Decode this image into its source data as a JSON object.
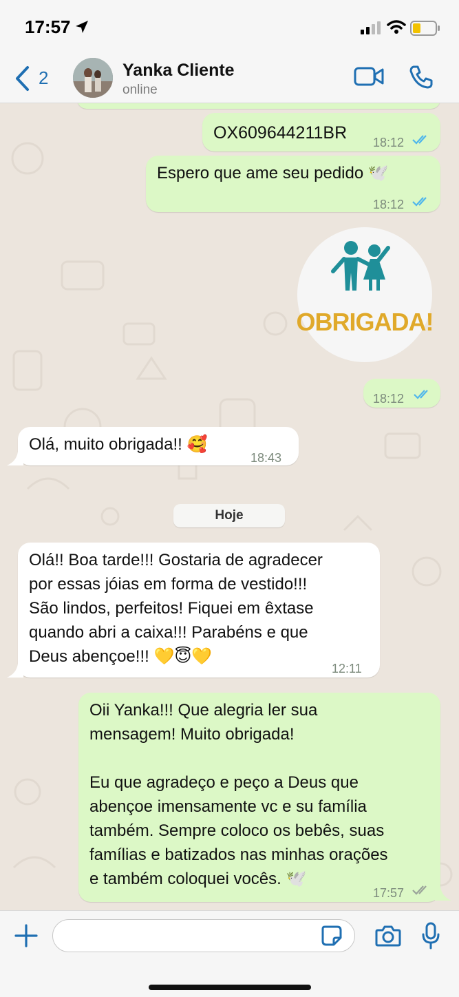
{
  "status_bar": {
    "time": "17:57"
  },
  "header": {
    "back_count": "2",
    "contact_name": "Yanka Cliente",
    "contact_status": "online"
  },
  "messages": [
    {
      "from": "me",
      "text": "OX609644211BR",
      "time": "18:12",
      "read": true
    },
    {
      "from": "me",
      "text": "Espero que ame seu pedido 🕊️",
      "time": "18:12",
      "read": true
    },
    {
      "from": "me",
      "type": "sticker",
      "sticker_text": "OBRIGADA!",
      "time": "18:12",
      "read": true
    },
    {
      "from": "them",
      "text": "Olá, muito obrigada!! 🥰",
      "time": "18:43"
    },
    {
      "from": "them",
      "text": "Olá!! Boa tarde!!! Gostaria de agradecer\npor essas jóias em forma de vestido!!!\nSão lindos, perfeitos! Fiquei em êxtase\nquando abri a caixa!!! Parabéns e que\nDeus abençoe!!! 💛😇💛",
      "time": "12:11"
    },
    {
      "from": "me",
      "text": "Oii Yanka!!! Que alegria ler sua\nmensagem! Muito obrigada!\n\nEu que agradeço e peço a Deus que\nabençoe imensamente vc e su família\ntambém. Sempre coloco os bebês, suas\nfamílias e batizados nas minhas orações\ne também coloquei vocês. 🕊️",
      "time": "17:57",
      "read": false
    }
  ],
  "date_divider": "Hoje",
  "input": {
    "placeholder": "",
    "value": ""
  },
  "colors": {
    "accent": "#1f6fb2",
    "outgoing_bubble": "#dcf8c6",
    "incoming_bubble": "#ffffff",
    "read_ticks": "#4fb6ec",
    "chat_background": "#ece5dd",
    "sticker_figures": "#1f8f99",
    "sticker_text": "#e0a92a"
  },
  "icons": {
    "back": "chevron-left-icon",
    "video": "video-camera-icon",
    "call": "phone-icon",
    "add": "plus-icon",
    "sticker": "sticker-icon",
    "camera": "camera-icon",
    "mic": "microphone-icon"
  }
}
